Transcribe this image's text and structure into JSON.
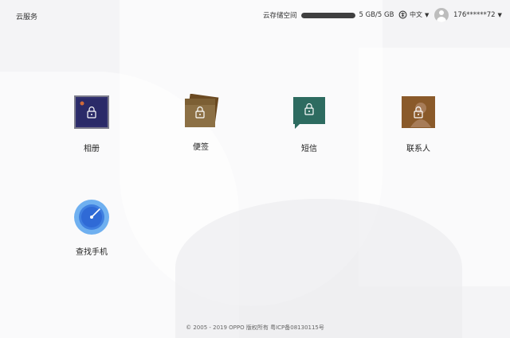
{
  "header": {
    "brand": "云服务",
    "storage_label": "云存储空间",
    "storage_value": "5 GB/5 GB",
    "storage_used_fraction": 1.0,
    "language": "中文",
    "username": "176******72"
  },
  "apps": [
    {
      "label": "相册",
      "icon": "photo-album-icon",
      "color": "#2f2e6e"
    },
    {
      "label": "便签",
      "icon": "notes-icon",
      "color": "#8a6a3c"
    },
    {
      "label": "短信",
      "icon": "sms-icon",
      "color": "#2e6b60"
    },
    {
      "label": "联系人",
      "icon": "contacts-icon",
      "color": "#8a5a2a"
    },
    {
      "label": "查找手机",
      "icon": "find-phone-icon",
      "color": "#4a8ee8"
    }
  ],
  "footer": {
    "copyright": "© 2005 - 2019 OPPO 版权所有 粤ICP备08130115号"
  }
}
